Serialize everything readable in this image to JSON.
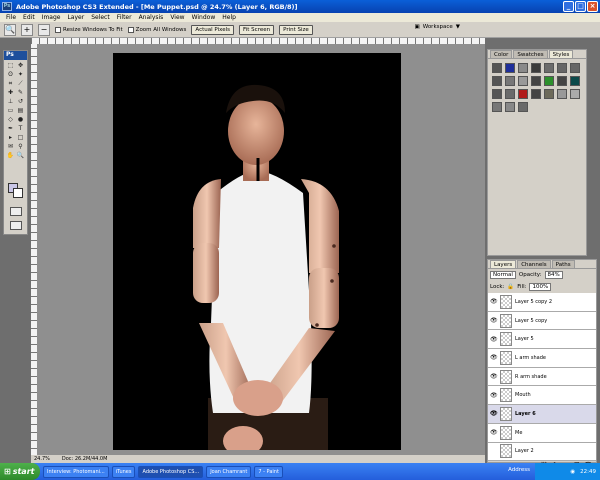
{
  "window": {
    "title": "Adobe Photoshop CS3 Extended - [Me Puppet.psd @ 24.7% (Layer 6, RGB/8)]"
  },
  "menu": {
    "items": [
      "File",
      "Edit",
      "Image",
      "Layer",
      "Select",
      "Filter",
      "Analysis",
      "View",
      "Window",
      "Help"
    ]
  },
  "options": {
    "resize_windows": "Resize Windows To Fit",
    "zoom_all": "Zoom All Windows",
    "actual_pixels": "Actual Pixels",
    "fit_screen": "Fit Screen",
    "print_size": "Print Size",
    "workspace": "Workspace"
  },
  "toolbox": {
    "logo": "Ps"
  },
  "document": {
    "zoom": "24.7%",
    "doc_size": "Doc: 26.2M/44.0M"
  },
  "styles_panel": {
    "tabs": [
      "Color",
      "Swatches",
      "Styles"
    ],
    "active_tab": "Styles",
    "style_colors": [
      "#555555",
      "#1f2f9a",
      "#8a8a8a",
      "#3b3b3b",
      "#6b6b6b",
      "#666666",
      "#666666",
      "#555555",
      "#777777",
      "#999999",
      "#444444",
      "#2c8f2c",
      "#444444",
      "#0c4a4a",
      "#555555",
      "#6a6a6a",
      "#b01a1a",
      "#444444",
      "#6d6a5a",
      "#999999",
      "#aaaaaa",
      "#777777",
      "#888888",
      "#6a6a6a"
    ]
  },
  "layers_panel": {
    "tabs": [
      "Layers",
      "Channels",
      "Paths"
    ],
    "active_tab": "Layers",
    "blend_mode": "Normal",
    "opacity_label": "Opacity:",
    "opacity": "84%",
    "lock_label": "Lock:",
    "fill_label": "Fill:",
    "fill": "100%",
    "layers": [
      {
        "name": "Layer 5 copy 2",
        "visible": true,
        "selected": false
      },
      {
        "name": "Layer 5 copy",
        "visible": true,
        "selected": false
      },
      {
        "name": "Layer 5",
        "visible": true,
        "selected": false
      },
      {
        "name": "L arm shade",
        "visible": true,
        "selected": false
      },
      {
        "name": "R arm shade",
        "visible": true,
        "selected": false
      },
      {
        "name": "Mouth",
        "visible": true,
        "selected": false
      },
      {
        "name": "Layer 6",
        "visible": true,
        "selected": true
      },
      {
        "name": "Me",
        "visible": true,
        "selected": false
      },
      {
        "name": "Layer 2",
        "visible": false,
        "selected": false
      }
    ]
  },
  "taskbar": {
    "start": "start",
    "tasks": [
      "Interview: Photomani...",
      "iTunes",
      "Adobe Photoshop CS...",
      "Joan Chamrant",
      "7 - Paint"
    ],
    "active_task": 2,
    "address_label": "Address",
    "clock": "22:49"
  }
}
